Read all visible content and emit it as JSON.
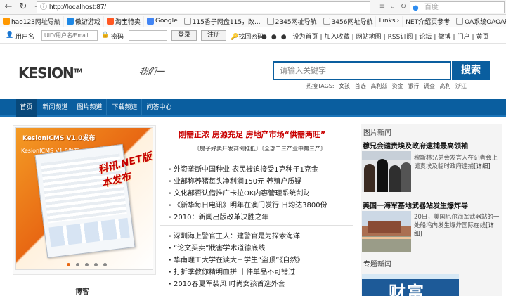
{
  "browser": {
    "url": "http://localhost:87/",
    "search_placeholder": "百度",
    "bookmarks": [
      "hao123网址导航",
      "傲游游戏",
      "淘宝特卖",
      "Google",
      "115香子网盘115，改...",
      "2345网址导航",
      "3456网址导航",
      "Links",
      "NET介绍页参考",
      "OA系统OAOA软件..."
    ]
  },
  "topbar": {
    "username_label": "用户名",
    "username_placeholder": "UID/用户名/Email",
    "password_label": "密码",
    "login_label": "登录",
    "register_label": "注册",
    "forgot_label": "找回密码",
    "links": [
      "设为首页",
      "加入收藏",
      "网站地图",
      "RSS订阅",
      "论坛",
      "微博",
      "门户",
      "黄页"
    ]
  },
  "header": {
    "logo_text": "KESION",
    "logo_tm": "TM",
    "signature": "我们一",
    "search_placeholder": "请输入关键字",
    "search_button": "搜索",
    "hot_tags_label": "热搜TAGS:",
    "hot_tags": [
      "女孩",
      "首选",
      "高利兹",
      "资金",
      "银行",
      "调查",
      "高利",
      "浙江"
    ]
  },
  "nav": {
    "items": [
      "首页",
      "新闻频道",
      "图片频道",
      "下载频道",
      "问答中心"
    ]
  },
  "slide": {
    "title": "KesionICMS V1.0发布",
    "sub": "KesionICMS V1.0发布",
    "overlay": "科讯.NET版本发布"
  },
  "main": {
    "headline": "刚需正浓 房源充足 房地产市场“供需两旺”",
    "subheadline": "〔房子好卖开发商倒推抵〕〔全部二三产业中第三产〕",
    "news_group_1": [
      "外资垄断中国种业 农民被迫接受1克种子1克金",
      "业部称养猪每头净利润150元 养殖户质疑",
      "文化部否认借推广卡拉OK内容管理系统剑财",
      "《新华每日电讯》明年在澳门发行 日均达3800份",
      "2010：新闻出版改革决胜之年"
    ],
    "news_group_2": [
      "深圳海上警官主人：建警官是为探索海洋",
      "“论文买卖”戕害学术道德底线",
      "华南理工大学在读大三学生“盗顶”《自然》",
      "打折季教你精明血拼 十件单品不可错过",
      "2010春夏军装风 时尚女孩首选外套"
    ]
  },
  "right": {
    "section_title": "图片新闻",
    "item1_title": "穆兄会谴责埃及政府逮捕最高领袖",
    "item1_desc": "穆斯林兄弟会发言人在记者会上谴责埃及临时政府逮捕",
    "item1_more": "[详细]",
    "item2_title": "美国一海军基地武器站发生爆炸导",
    "item2_desc": "20日，美国厄尔海军武器站的一处船坞内发生爆炸国际在线",
    "item2_more": "[详细]",
    "topics_title": "专题新闻",
    "banner_text": "财富"
  },
  "left": {
    "blog_title": "博客"
  },
  "colors": {
    "nav_blue": "#0a5e9f",
    "headline_red": "#c90000",
    "slide_orange": "#e86813"
  }
}
